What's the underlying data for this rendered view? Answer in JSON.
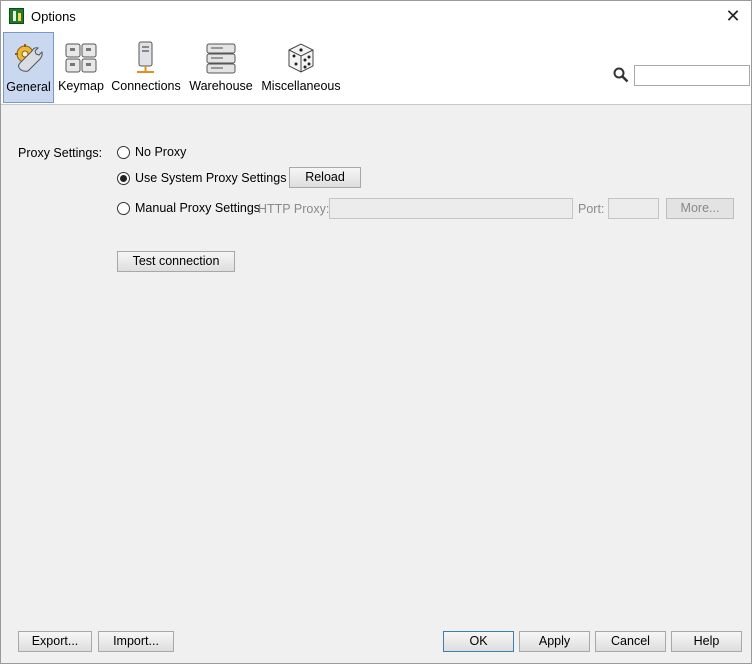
{
  "window": {
    "title": "Options",
    "close_glyph": "✕"
  },
  "toolbar": {
    "items": [
      {
        "label": "General",
        "icon": "general-settings-icon",
        "selected": true
      },
      {
        "label": "Keymap",
        "icon": "keyboard-icon",
        "selected": false
      },
      {
        "label": "Connections",
        "icon": "network-connections-icon",
        "selected": false
      },
      {
        "label": "Warehouse",
        "icon": "server-drives-icon",
        "selected": false
      },
      {
        "label": "Miscellaneous",
        "icon": "dice-icon",
        "selected": false
      }
    ],
    "search": {
      "value": "",
      "placeholder": ""
    }
  },
  "proxy": {
    "label": "Proxy Settings:",
    "options": [
      {
        "label": "No Proxy",
        "checked": false
      },
      {
        "label": "Use System Proxy Settings",
        "checked": true
      },
      {
        "label": "Manual Proxy Settings",
        "checked": false
      }
    ],
    "reload_label": "Reload",
    "http_proxy_label": "HTTP Proxy:",
    "http_proxy_value": "",
    "port_label": "Port:",
    "port_value": "",
    "more_label": "More..."
  },
  "test_connection_label": "Test connection",
  "footer": {
    "export_label": "Export...",
    "import_label": "Import...",
    "ok_label": "OK",
    "apply_label": "Apply",
    "cancel_label": "Cancel",
    "help_label": "Help"
  },
  "colors": {
    "selected_tab_bg": "#c9d7ef",
    "selected_tab_border": "#7a97c7",
    "ok_border": "#3c7fb1"
  }
}
